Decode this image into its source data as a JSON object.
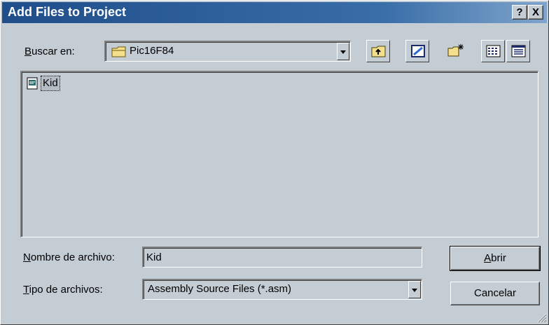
{
  "window": {
    "title": "Add Files to Project",
    "help_label": "?",
    "close_label": "X"
  },
  "look_in": {
    "label_u": "B",
    "label_rest": "uscar en:",
    "value": "Pic16F84"
  },
  "toolbar": {
    "up_icon": "up-one-level-icon",
    "desktop_icon": "desktop-icon",
    "new_folder_icon": "new-folder-icon",
    "list_icon": "list-view-icon",
    "details_icon": "details-view-icon"
  },
  "files": [
    {
      "name": "Kid",
      "icon": "source-file-icon"
    }
  ],
  "filename": {
    "label_u": "N",
    "label_rest": "ombre de archivo:",
    "value": "Kid"
  },
  "filetype": {
    "label_u": "T",
    "label_rest": "ipo de archivos:",
    "value": "Assembly Source Files (*.asm)"
  },
  "buttons": {
    "open_u": "A",
    "open_rest": "brir",
    "cancel": "Cancelar"
  },
  "colors": {
    "title_bar": "#1f4e8a",
    "dialog_bg": "#c4ccd4"
  }
}
